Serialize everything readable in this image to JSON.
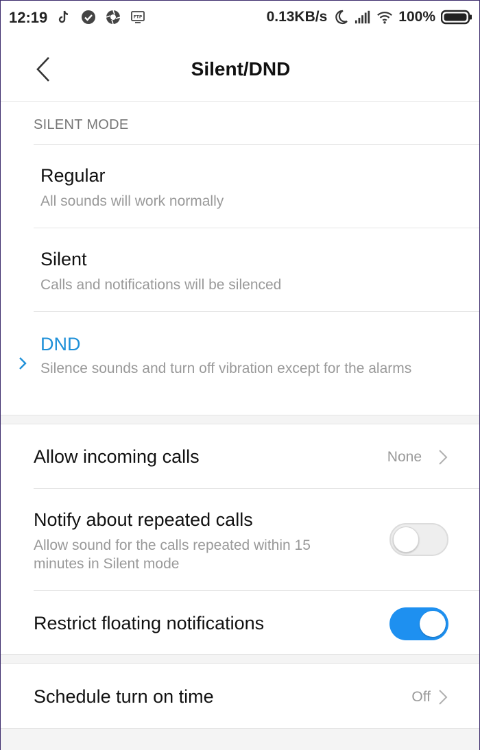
{
  "status_bar": {
    "time": "12:19",
    "net_speed": "0.13KB/s",
    "battery": "100%"
  },
  "header": {
    "title": "Silent/DND"
  },
  "silent_mode": {
    "section_label": "SILENT MODE",
    "options": [
      {
        "title": "Regular",
        "desc": "All sounds will work normally",
        "selected": false
      },
      {
        "title": "Silent",
        "desc": "Calls and notifications will be silenced",
        "selected": false
      },
      {
        "title": "DND",
        "desc": "Silence sounds and turn off vibration except for the alarms",
        "selected": true
      }
    ]
  },
  "settings": {
    "incoming_calls": {
      "title": "Allow incoming calls",
      "value": "None"
    },
    "repeated_calls": {
      "title": "Notify about repeated calls",
      "desc": "Allow sound for the calls repeated within 15 minutes in Silent mode",
      "enabled": false
    },
    "floating": {
      "title": "Restrict floating notifications",
      "enabled": true
    },
    "schedule": {
      "title": "Schedule turn on time",
      "value": "Off"
    }
  },
  "colors": {
    "accent": "#1e90d8",
    "toggle_on": "#1e90f0"
  }
}
